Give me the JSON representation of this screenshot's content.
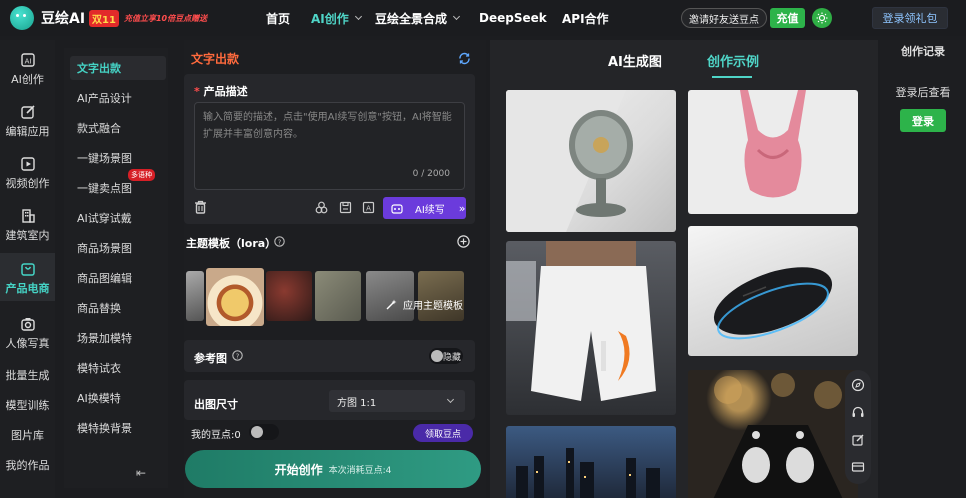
{
  "header": {
    "logo_text": "豆绘AI",
    "promo_badge": "双11",
    "promo_text": "充值立享10倍豆点赠送",
    "nav": [
      {
        "label": "首页"
      },
      {
        "label": "AI创作",
        "active": true,
        "has_dropdown": true
      },
      {
        "label": "豆绘全景合成",
        "has_dropdown": true
      },
      {
        "label": "DeepSeek"
      },
      {
        "label": "API合作"
      }
    ],
    "invite_label": "邀请好友送豆点",
    "recharge_label": "充值",
    "login_label": "登录领礼包"
  },
  "left_nav": {
    "items": [
      {
        "label": "AI创作",
        "icon": "ai-icon"
      },
      {
        "label": "编辑应用",
        "icon": "edit-icon"
      },
      {
        "label": "视频创作",
        "icon": "video-icon"
      },
      {
        "label": "建筑室内",
        "icon": "building-icon"
      },
      {
        "label": "产品电商",
        "icon": "shop-icon",
        "active": true
      },
      {
        "label": "人像写真",
        "icon": "camera-icon"
      }
    ],
    "text_items": [
      "批量生成",
      "模型训练",
      "图片库",
      "我的作品"
    ]
  },
  "sub_nav": {
    "items": [
      {
        "label": "文字出款",
        "active": true
      },
      {
        "label": "AI产品设计"
      },
      {
        "label": "款式融合"
      },
      {
        "label": "一键场景图"
      },
      {
        "label": "一键卖点图",
        "tag": "多语种"
      },
      {
        "label": "AI试穿试戴"
      },
      {
        "label": "商品场景图"
      },
      {
        "label": "商品图编辑"
      },
      {
        "label": "商品替换"
      },
      {
        "label": "场景加模特"
      },
      {
        "label": "模特试衣"
      },
      {
        "label": "AI换模特"
      },
      {
        "label": "模特换背景"
      }
    ]
  },
  "panel": {
    "title": "文字出款",
    "description_label": "产品描述",
    "required_mark": "*",
    "description_placeholder": "输入简要的描述，点击\"使用AI续写创意\"按钮，AI将智能扩展并丰富创意内容。",
    "counter": "0 / 2000",
    "ai_write_label": "AI续写",
    "theme_label": "主题模板（lora）",
    "apply_theme_label": "应用主题模板",
    "reference_label": "参考图",
    "hide_label": "隐藏",
    "size_label": "出图尺寸",
    "size_value": "方图 1:1",
    "beans_label": "我的豆点:0",
    "claim_label": "领取豆点",
    "start_label": "开始创作",
    "cost_label": "本次消耗豆点:4"
  },
  "gallery": {
    "tabs": [
      {
        "label": "AI生成图"
      },
      {
        "label": "创作示例",
        "active": true
      }
    ]
  },
  "right_panel": {
    "title": "创作记录",
    "hint": "登录后查看",
    "login_label": "登录"
  },
  "colors": {
    "accent": "#4fd5c7",
    "primary_green": "#2db34a",
    "purple": "#6b3bdc",
    "danger": "#d61f26"
  }
}
